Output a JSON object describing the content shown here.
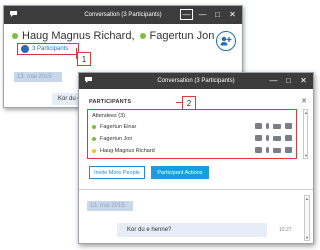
{
  "window1": {
    "title": "Conversation (3 Participants)",
    "names": [
      "Haug Magnus Richard,",
      "Fagertun Jon"
    ],
    "participants_link": "3 Participants",
    "date_chip": "13. mai 2015",
    "message": "Kor du e",
    "callout_number": "1",
    "controls": {
      "minimize": "—",
      "restore": "□",
      "close": "✕",
      "pop": "—"
    }
  },
  "window2": {
    "title": "Conversation (3 Participants)",
    "section_label": "PARTICIPANTS",
    "close_label": "✕",
    "callout_number": "2",
    "attendees_header": "Attendees (3)",
    "attendees": [
      {
        "name": "Fagertun Einar",
        "status": "#7cbf3a"
      },
      {
        "name": "Fagertun Jon",
        "status": "#7cbf3a"
      },
      {
        "name": "Haug Magnus Richard",
        "status": "#f0c419"
      }
    ],
    "invite_button": "Invite More People",
    "actions_button": "Participant Actions",
    "date_chip": "13. mai 2015",
    "message": "Kor du e henne?",
    "time": "10:27",
    "controls": {
      "minimize": "—",
      "restore": "□",
      "close": "✕"
    }
  },
  "colors": {
    "accent": "#1e9be0",
    "highlight": "#d93a3a",
    "titlebar": "#3c3c3c",
    "presence_available": "#7cbf3a",
    "presence_away": "#f0c419"
  },
  "icons": {
    "chat": "chat-bubble-icon",
    "add_person": "add-person-icon",
    "attendee_actions": [
      "chat-icon",
      "microphone-icon",
      "video-icon",
      "more-icon"
    ]
  }
}
